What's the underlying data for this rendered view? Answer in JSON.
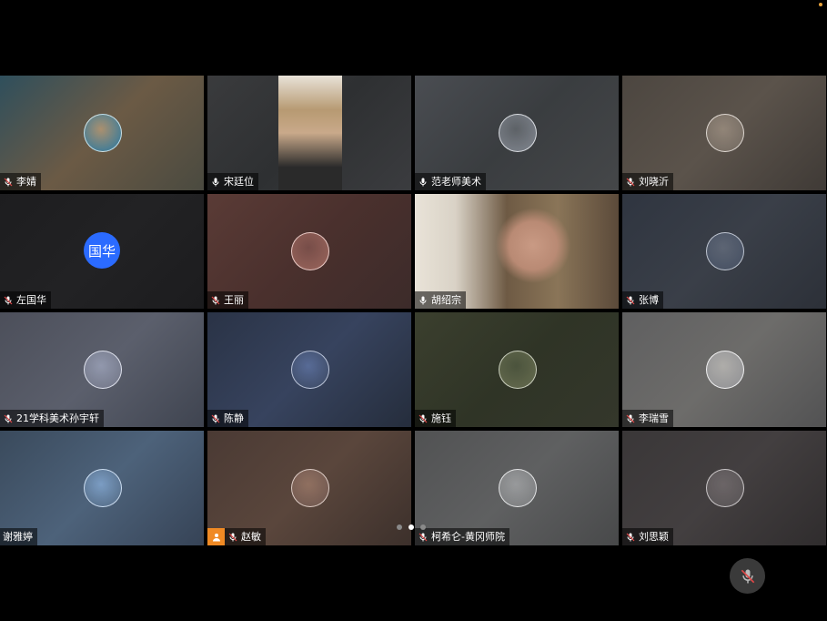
{
  "participants": [
    {
      "name": "李婧",
      "mic": "muted",
      "avatar": "photo",
      "colors": [
        "#2f4f5c",
        "#6b5a45",
        "#4a4a40"
      ]
    },
    {
      "name": "宋廷位",
      "mic": "on",
      "avatar": "video",
      "colors": [
        "#3a3b3d",
        "#2e3032",
        "#3b3c3f"
      ]
    },
    {
      "name": "范老师美术",
      "mic": "on",
      "avatar": "photo",
      "colors": [
        "#4a4d52",
        "#3a3d40",
        "#454749"
      ]
    },
    {
      "name": "刘晓沂",
      "mic": "muted",
      "avatar": "photo",
      "colors": [
        "#4c4640",
        "#5b534b",
        "#3f3a36"
      ]
    },
    {
      "name": "左国华",
      "mic": "muted",
      "avatar": "text",
      "avatar_text": "国华",
      "colors": [
        "#1d1d1f",
        "#222224",
        "#1c1c1e"
      ]
    },
    {
      "name": "王丽",
      "mic": "muted",
      "avatar": "photo",
      "colors": [
        "#5a3b36",
        "#4a302d",
        "#3c2b2a"
      ]
    },
    {
      "name": "胡绍宗",
      "mic": "on",
      "avatar": "video",
      "colors": [
        "#bfb7a8",
        "#7c6a55",
        "#2b2a28"
      ]
    },
    {
      "name": "张博",
      "mic": "muted",
      "avatar": "photo",
      "colors": [
        "#2f3540",
        "#3a3f48",
        "#2c3038"
      ]
    },
    {
      "name": "21学科美术孙宇轩",
      "mic": "muted",
      "avatar": "photo",
      "colors": [
        "#4c4f5a",
        "#5b5f6c",
        "#3f4450"
      ]
    },
    {
      "name": "陈静",
      "mic": "muted",
      "avatar": "photo",
      "colors": [
        "#2a3346",
        "#37435e",
        "#252d3c"
      ]
    },
    {
      "name": "施钰",
      "mic": "muted",
      "avatar": "photo",
      "colors": [
        "#3b3f2e",
        "#2f3426",
        "#34372b"
      ]
    },
    {
      "name": "李瑞雪",
      "mic": "muted",
      "avatar": "photo",
      "colors": [
        "#5f5f60",
        "#6d6c6a",
        "#525253"
      ]
    },
    {
      "name": "谢雅婷",
      "mic": "none",
      "avatar": "photo",
      "colors": [
        "#3a4a5c",
        "#4d627a",
        "#364356"
      ]
    },
    {
      "name": "赵敏",
      "mic": "muted",
      "avatar": "photo",
      "host": true,
      "colors": [
        "#4a3a34",
        "#5a463c",
        "#3c302b"
      ]
    },
    {
      "name": "柯希仑-黄冈师院",
      "mic": "muted",
      "avatar": "photo",
      "colors": [
        "#515253",
        "#5f6061",
        "#48494a"
      ]
    },
    {
      "name": "刘思颖",
      "mic": "muted",
      "avatar": "photo",
      "colors": [
        "#3a3738",
        "#433f40",
        "#2f2c2d"
      ]
    }
  ],
  "active_speaker": "范老师美术",
  "pager": {
    "pages": 3,
    "current": 2
  },
  "controls": {
    "mute_icon": "mic-off-icon"
  }
}
